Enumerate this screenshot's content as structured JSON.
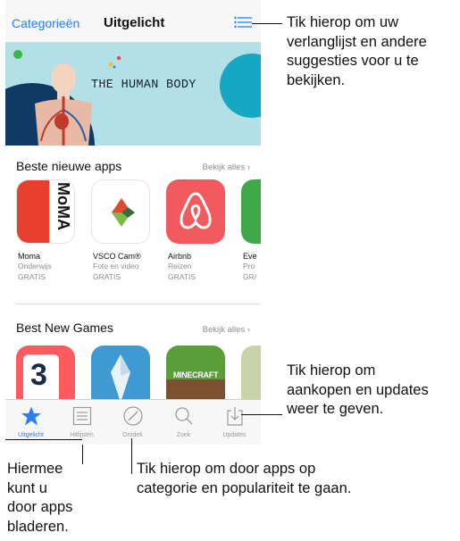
{
  "navbar": {
    "categories_label": "Categorieën",
    "title": "Uitgelicht"
  },
  "banner": {
    "text": "THE HUMAN BODY"
  },
  "section1": {
    "title": "Beste nieuwe apps",
    "see_all": "Bekijk alles",
    "apps": [
      {
        "name": "Moma",
        "category": "Onderwijs",
        "price": "GRATIS",
        "icon_text": "MoMA"
      },
      {
        "name": "VSCO Cam®",
        "category": "Foto en video",
        "price": "GRATIS"
      },
      {
        "name": "Airbnb",
        "category": "Reizen",
        "price": "GRATIS"
      },
      {
        "name": "Eve",
        "category": "Pro",
        "price": "GR/"
      }
    ]
  },
  "section2": {
    "title": "Best New Games",
    "see_all": "Bekijk alles",
    "games": [
      {
        "icon_text": "3"
      },
      {
        "icon_text": ""
      },
      {
        "icon_text": "MINECRAFT"
      },
      {
        "icon_text": ""
      }
    ]
  },
  "tabbar": {
    "tabs": [
      {
        "label": "Uitgelicht",
        "icon": "star-icon"
      },
      {
        "label": "Hitlijsten",
        "icon": "list-icon"
      },
      {
        "label": "Ontdek",
        "icon": "compass-icon"
      },
      {
        "label": "Zoek",
        "icon": "search-icon"
      },
      {
        "label": "Updates",
        "icon": "download-icon"
      }
    ]
  },
  "callouts": {
    "wishlist": [
      "Tik hierop om uw",
      "verlanglijst en andere",
      "suggesties voor u te",
      "bekijken."
    ],
    "updates": [
      "Tik hierop om",
      "aankopen en updates",
      "weer te geven."
    ],
    "browse": [
      "Hiermee",
      "kunt u",
      "door apps",
      "bladeren."
    ],
    "explore": [
      "Tik hierop om door apps op",
      "categorie en populariteit te gaan."
    ]
  },
  "colors": {
    "accent": "#2a7ff5",
    "banner_bg": "#b2e0e6",
    "tabbar_bg": "#f7f7f7",
    "moma_red": "#e8402e",
    "airbnb_red": "#f15b5f"
  }
}
